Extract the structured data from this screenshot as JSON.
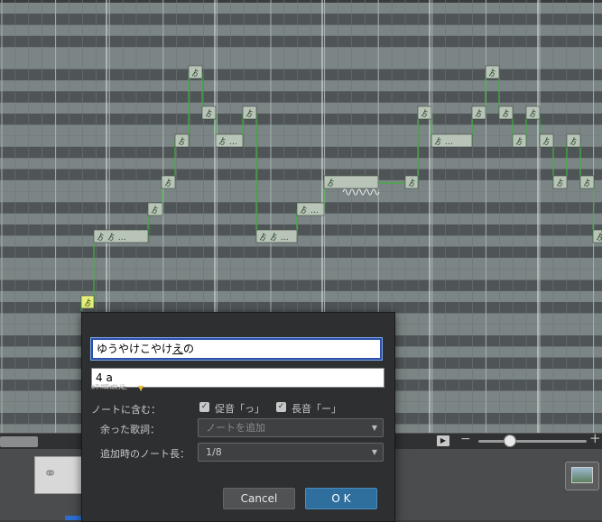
{
  "dialog": {
    "lyric_value": "ゆうやけこやけえの",
    "lyric_prefix": "ゆうやけこやけ",
    "lyric_underlined": "え",
    "lyric_suffix": "の",
    "phoneme_value": "4 a",
    "detail_label": "詳細設定",
    "include_label": "ノートに含む：",
    "sokuon_label": "促音「っ」",
    "chouon_label": "長音「ー」",
    "surplus_label": "余った歌詞：",
    "surplus_value": "ノートを追加",
    "note_length_label": "追加時のノート長：",
    "note_length_value": "1/8",
    "cancel_label": "Cancel",
    "ok_label": "O K"
  },
  "notes": [
    {
      "label": "ゟ"
    },
    {
      "label": "ゟ ゟ …"
    },
    {
      "label": "ゟ"
    },
    {
      "label": "ゟ"
    },
    {
      "label": "ゟ"
    },
    {
      "label": "ゟ"
    },
    {
      "label": "ゟ"
    },
    {
      "label": "ゟ …"
    },
    {
      "label": "ゟ"
    },
    {
      "label": "ゟ ゟ …"
    },
    {
      "label": "ゟ …"
    },
    {
      "label": "ゟ"
    },
    {
      "label": "ゟ"
    },
    {
      "label": "ゟ"
    },
    {
      "label": "ゟ …"
    },
    {
      "label": "ゟ"
    },
    {
      "label": "ゟ"
    },
    {
      "label": "ゟ"
    },
    {
      "label": "ゟ"
    },
    {
      "label": "ゟ"
    },
    {
      "label": "ゟ"
    },
    {
      "label": "ゟ"
    },
    {
      "label": "ゟ"
    },
    {
      "label": "ゟ"
    },
    {
      "label": "ゟ"
    }
  ],
  "colors": {
    "note_fill": "#b8c4b8",
    "note_selected": "#e8f07a",
    "pitch_line": "#3fb23f",
    "ok_button": "#2f6f9e"
  },
  "icons": {
    "play": "play-icon",
    "link": "link-icon",
    "image": "image-icon"
  }
}
